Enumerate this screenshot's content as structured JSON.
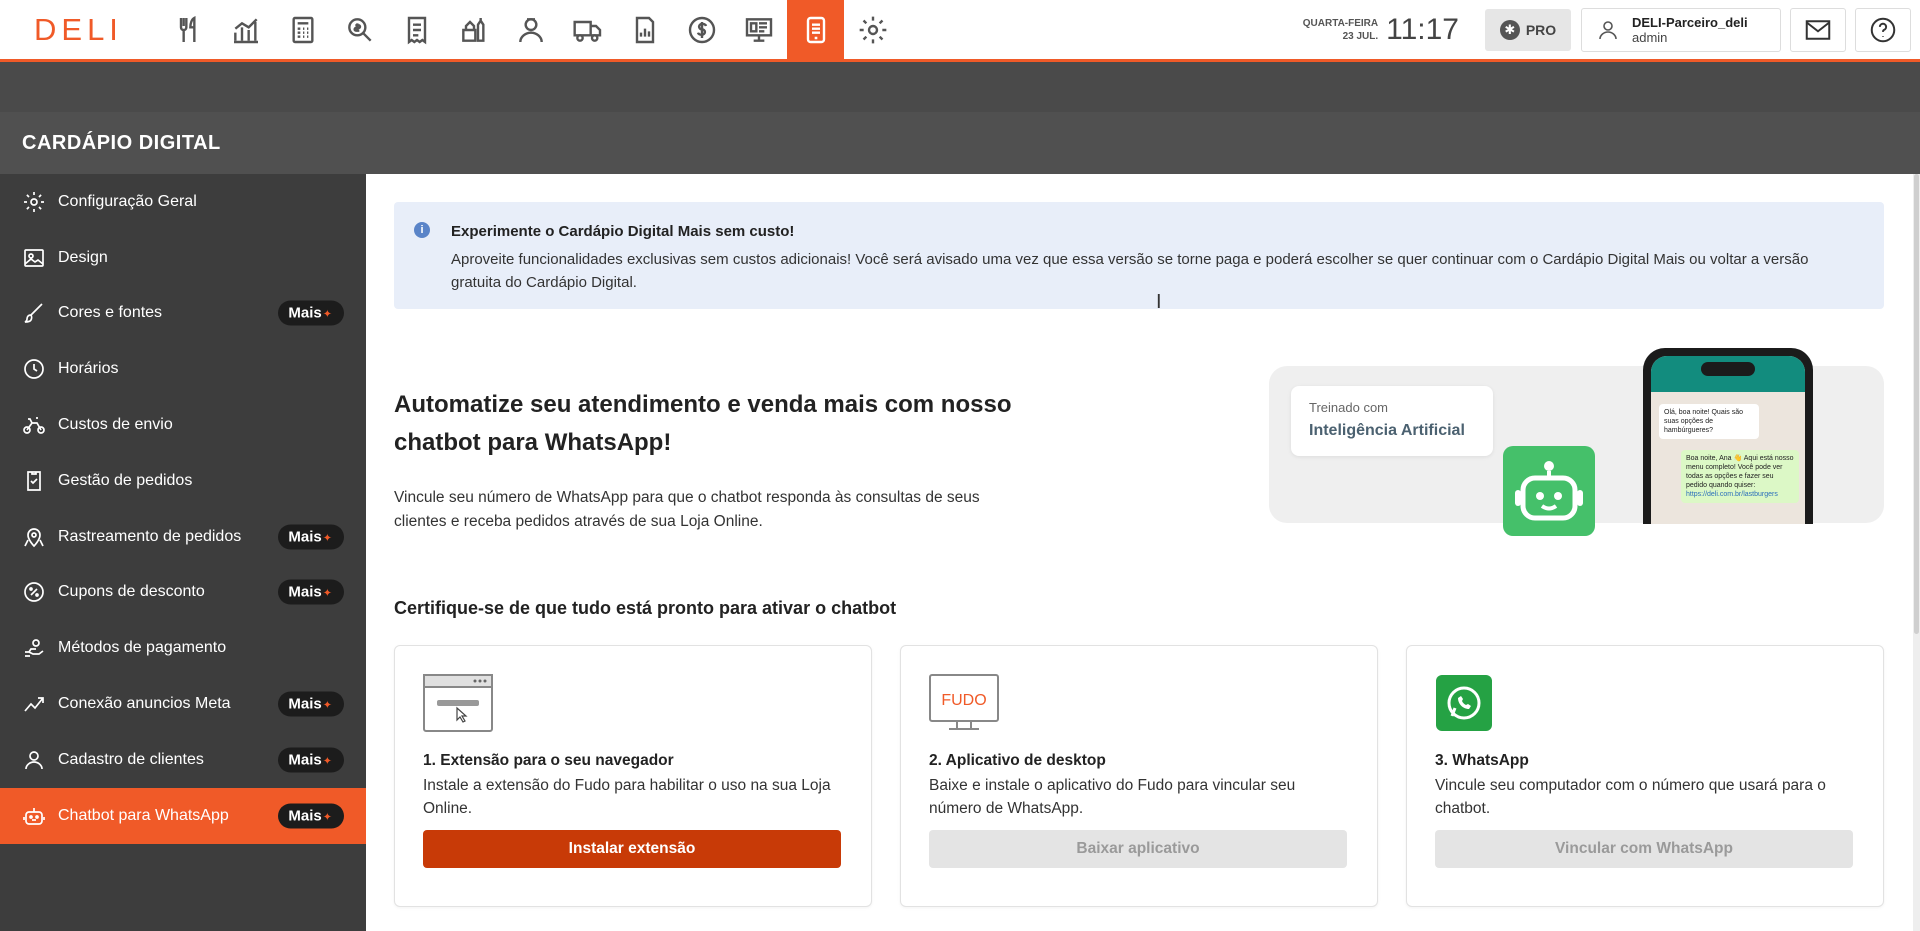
{
  "app": {
    "logo": "DELI"
  },
  "topbar": {
    "weekday": "QUARTA-FEIRA",
    "date": "23 JUL.",
    "time": "11:17",
    "pro": "PRO",
    "user_name": "DELI-Parceiro_deli",
    "user_role": "admin"
  },
  "nav_icons": [
    "fork-knife-icon",
    "chart-icon",
    "calculator-icon",
    "search-money-icon",
    "receipt-icon",
    "ingredients-icon",
    "user-icon",
    "truck-icon",
    "report-icon",
    "dollar-icon",
    "screen-icon",
    "digital-menu-icon",
    "gear-icon"
  ],
  "section": {
    "title": "CARDÁPIO DIGITAL"
  },
  "sidebar": {
    "mais_label": "Mais",
    "items": [
      {
        "label": "Configuração Geral",
        "icon": "gear-icon",
        "mais": false
      },
      {
        "label": "Design",
        "icon": "image-icon",
        "mais": false
      },
      {
        "label": "Cores e fontes",
        "icon": "brush-icon",
        "mais": true
      },
      {
        "label": "Horários",
        "icon": "clock-icon",
        "mais": false
      },
      {
        "label": "Custos de envio",
        "icon": "bike-icon",
        "mais": false
      },
      {
        "label": "Gestão de pedidos",
        "icon": "check-list-icon",
        "mais": false
      },
      {
        "label": "Rastreamento de pedidos",
        "icon": "map-pin-icon",
        "mais": true
      },
      {
        "label": "Cupons de desconto",
        "icon": "percent-icon",
        "mais": true
      },
      {
        "label": "Métodos de pagamento",
        "icon": "payment-icon",
        "mais": false
      },
      {
        "label": "Conexão anuncios Meta",
        "icon": "trend-icon",
        "mais": true
      },
      {
        "label": "Cadastro de clientes",
        "icon": "user-icon",
        "mais": true
      },
      {
        "label": "Chatbot para WhatsApp",
        "icon": "robot-icon",
        "mais": true,
        "active": true
      }
    ]
  },
  "banner": {
    "title": "Experimente o Cardápio Digital Mais sem custo!",
    "text": "Aproveite funcionalidades exclusivas sem custos adicionais! Você será avisado uma vez que essa versão se torne paga e poderá escolher se quer continuar com o Cardápio Digital Mais ou voltar a versão gratuita do Cardápio Digital."
  },
  "hero": {
    "title": "Automatize seu atendimento e venda mais com nosso chatbot para WhatsApp!",
    "text": "Vincule seu número de WhatsApp para que o chatbot responda às consultas de seus clientes e receba pedidos através de sua Loja Online.",
    "ia_line1": "Treinado com",
    "ia_line2": "Inteligência Artificial",
    "chat_in": "Olá, boa noite! Quais são suas opções de hambúrgueres?",
    "chat_out": "Boa noite, Ana 👋 Aqui está nosso menu completo! Você pode ver todas as opções e fazer seu pedido quando quiser:",
    "chat_link": "https://deli.com.br/lastburgers"
  },
  "checklist": {
    "title": "Certifique-se de que tudo está pronto para ativar o chatbot",
    "cards": [
      {
        "title": "1. Extensão para o seu navegador",
        "text": "Instale a extensão do Fudo para habilitar o uso na sua Loja Online.",
        "button": "Instalar extensão",
        "icon": "browser-icon"
      },
      {
        "title": "2. Aplicativo de desktop",
        "text": "Baixe e instale o aplicativo do Fudo para vincular seu número de WhatsApp.",
        "button": "Baixar aplicativo",
        "icon": "fudo-monitor-icon",
        "monitor_text": "FUDO"
      },
      {
        "title": "3. WhatsApp",
        "text": "Vincule seu computador com o número que usará para o chatbot.",
        "button": "Vincular com WhatsApp",
        "icon": "whatsapp-icon"
      }
    ]
  },
  "colors": {
    "accent": "#f05a28",
    "primary_button": "#c83a07",
    "sidebar": "#3d3d3d",
    "banner": "#e8eef9",
    "whatsapp": "#25d366"
  }
}
